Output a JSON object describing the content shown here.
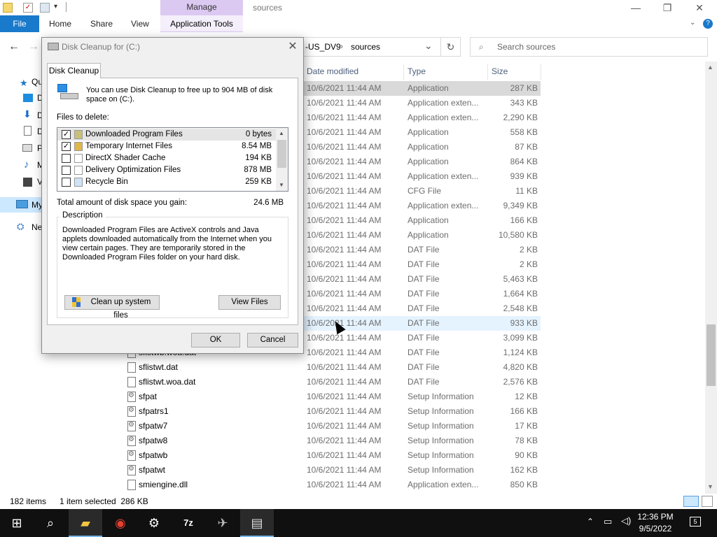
{
  "titlebar": {
    "manage_tab": "Manage",
    "title": "sources",
    "minimize": "—",
    "maximize": "❐",
    "close": "✕"
  },
  "ribbon": {
    "file": "File",
    "home": "Home",
    "share": "Share",
    "view": "View",
    "app_tools": "Application Tools"
  },
  "address": {
    "path_partial": "-US_DV9",
    "path_sep": "›",
    "current": "sources",
    "search_placeholder": "Search sources"
  },
  "nav": {
    "items": [
      "Qu",
      "D",
      "D",
      "D",
      "P",
      "M",
      "V",
      "My",
      "Ne"
    ]
  },
  "columns": {
    "date": "Date modified",
    "type": "Type",
    "size": "Size"
  },
  "files": [
    {
      "name": "",
      "date": "10/6/2021 11:44 AM",
      "type": "Application",
      "size": "287 KB"
    },
    {
      "name": "",
      "date": "10/6/2021 11:44 AM",
      "type": "Application exten...",
      "size": "343 KB"
    },
    {
      "name": "",
      "date": "10/6/2021 11:44 AM",
      "type": "Application exten...",
      "size": "2,290 KB"
    },
    {
      "name": "",
      "date": "10/6/2021 11:44 AM",
      "type": "Application",
      "size": "558 KB"
    },
    {
      "name": "",
      "date": "10/6/2021 11:44 AM",
      "type": "Application",
      "size": "87 KB"
    },
    {
      "name": "",
      "date": "10/6/2021 11:44 AM",
      "type": "Application",
      "size": "864 KB"
    },
    {
      "name": "",
      "date": "10/6/2021 11:44 AM",
      "type": "Application exten...",
      "size": "939 KB"
    },
    {
      "name": "",
      "date": "10/6/2021 11:44 AM",
      "type": "CFG File",
      "size": "11 KB"
    },
    {
      "name": "",
      "date": "10/6/2021 11:44 AM",
      "type": "Application exten...",
      "size": "9,349 KB"
    },
    {
      "name": "",
      "date": "10/6/2021 11:44 AM",
      "type": "Application",
      "size": "166 KB"
    },
    {
      "name": "",
      "date": "10/6/2021 11:44 AM",
      "type": "Application",
      "size": "10,580 KB"
    },
    {
      "name": "",
      "date": "10/6/2021 11:44 AM",
      "type": "DAT File",
      "size": "2 KB"
    },
    {
      "name": "",
      "date": "10/6/2021 11:44 AM",
      "type": "DAT File",
      "size": "2 KB"
    },
    {
      "name": "",
      "date": "10/6/2021 11:44 AM",
      "type": "DAT File",
      "size": "5,463 KB"
    },
    {
      "name": "",
      "date": "10/6/2021 11:44 AM",
      "type": "DAT File",
      "size": "1,664 KB"
    },
    {
      "name": "",
      "date": "10/6/2021 11:44 AM",
      "type": "DAT File",
      "size": "2,548 KB"
    },
    {
      "name": "",
      "date": "10/6/2021 11:44 AM",
      "type": "DAT File",
      "size": "933 KB"
    },
    {
      "name": "",
      "date": "10/6/2021 11:44 AM",
      "type": "DAT File",
      "size": "3,099 KB"
    },
    {
      "name": "sflstwb.woa.dat",
      "date": "10/6/2021 11:44 AM",
      "type": "DAT File",
      "size": "1,124 KB"
    },
    {
      "name": "sflistwt.dat",
      "date": "10/6/2021 11:44 AM",
      "type": "DAT File",
      "size": "4,820 KB"
    },
    {
      "name": "sflistwt.woa.dat",
      "date": "10/6/2021 11:44 AM",
      "type": "DAT File",
      "size": "2,576 KB"
    },
    {
      "name": "sfpat",
      "date": "10/6/2021 11:44 AM",
      "type": "Setup Information",
      "size": "12 KB"
    },
    {
      "name": "sfpatrs1",
      "date": "10/6/2021 11:44 AM",
      "type": "Setup Information",
      "size": "166 KB"
    },
    {
      "name": "sfpatw7",
      "date": "10/6/2021 11:44 AM",
      "type": "Setup Information",
      "size": "17 KB"
    },
    {
      "name": "sfpatw8",
      "date": "10/6/2021 11:44 AM",
      "type": "Setup Information",
      "size": "78 KB"
    },
    {
      "name": "sfpatwb",
      "date": "10/6/2021 11:44 AM",
      "type": "Setup Information",
      "size": "90 KB"
    },
    {
      "name": "sfpatwt",
      "date": "10/6/2021 11:44 AM",
      "type": "Setup Information",
      "size": "162 KB"
    },
    {
      "name": "smiengine.dll",
      "date": "10/6/2021 11:44 AM",
      "type": "Application exten...",
      "size": "850 KB"
    }
  ],
  "status": {
    "count": "182 items",
    "selection": "1 item selected  286 KB"
  },
  "taskbar": {
    "time": "12:36 PM",
    "date": "9/5/2022",
    "notif_count": "5"
  },
  "dialog": {
    "title": "Disk Cleanup for  (C:)",
    "tab": "Disk Cleanup",
    "intro": "You can use Disk Cleanup to free up to 904 MB of disk space on  (C:).",
    "files_label": "Files to delete:",
    "items": [
      {
        "name": "Downloaded Program Files",
        "size": "0 bytes",
        "checked": "✓"
      },
      {
        "name": "Temporary Internet Files",
        "size": "8.54 MB",
        "checked": "✓"
      },
      {
        "name": "DirectX Shader Cache",
        "size": "194 KB",
        "checked": ""
      },
      {
        "name": "Delivery Optimization Files",
        "size": "878 MB",
        "checked": ""
      },
      {
        "name": "Recycle Bin",
        "size": "259 KB",
        "checked": ""
      }
    ],
    "total_label": "Total amount of disk space you gain:",
    "total_value": "24.6 MB",
    "desc_title": "Description",
    "desc_text": "Downloaded Program Files are ActiveX controls and Java applets downloaded automatically from the Internet when you view certain pages. They are temporarily stored in the Downloaded Program Files folder on your hard disk.",
    "cleanup_btn": "Clean up system files",
    "view_files_btn": "View Files",
    "ok": "OK",
    "cancel": "Cancel"
  }
}
